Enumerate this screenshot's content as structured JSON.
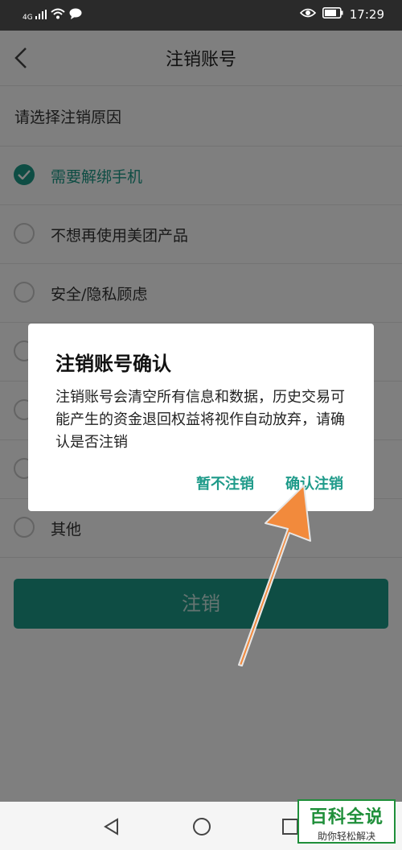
{
  "status_bar": {
    "signal_label": "4G",
    "time": "17:29"
  },
  "header": {
    "title": "注销账号"
  },
  "section": {
    "heading": "请选择注销原因"
  },
  "reasons": [
    {
      "label": "需要解绑手机",
      "selected": true
    },
    {
      "label": "不想再使用美团产品",
      "selected": false
    },
    {
      "label": "安全/隐私顾虑",
      "selected": false
    },
    {
      "label": "",
      "selected": false
    },
    {
      "label": "",
      "selected": false
    },
    {
      "label": "",
      "selected": false
    },
    {
      "label": "其他",
      "selected": false
    }
  ],
  "submit": {
    "label": "注销"
  },
  "dialog": {
    "title": "注销账号确认",
    "message": "注销账号会清空所有信息和数据，历史交易可能产生的资金退回权益将视作自动放弃，请确认是否注销",
    "cancel_label": "暂不注销",
    "confirm_label": "确认注销"
  },
  "watermark": {
    "title": "百科全说",
    "subtitle": "助你轻松解决"
  },
  "colors": {
    "accent": "#1d9a89",
    "arrow": "#f28a3c",
    "watermark": "#1f8f3a"
  }
}
